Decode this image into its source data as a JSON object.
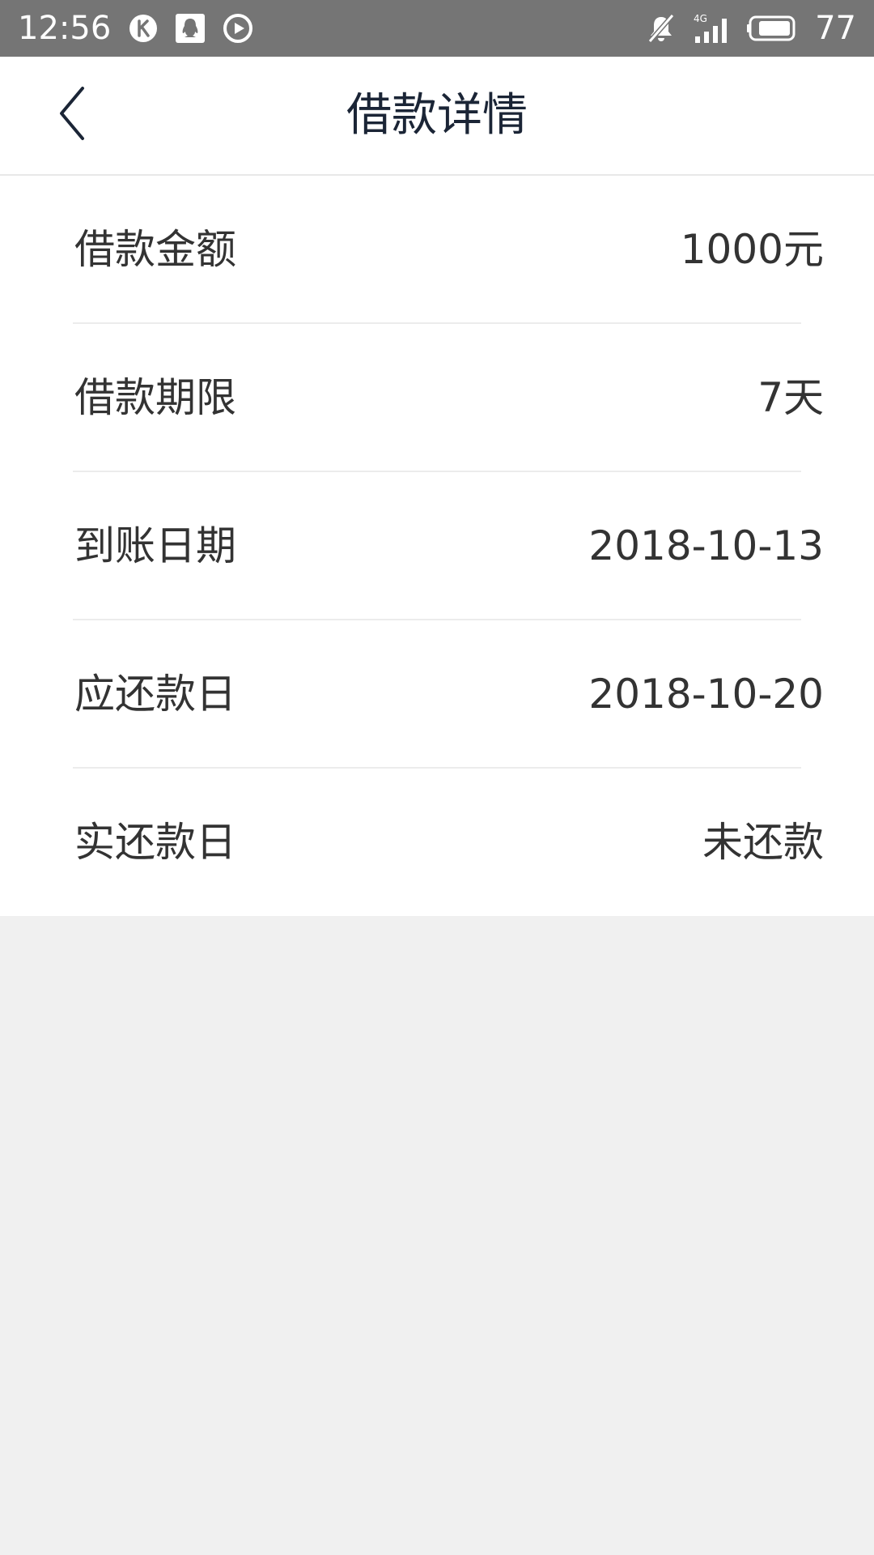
{
  "status_bar": {
    "time": "12:56",
    "icons_left": [
      "k-app-icon",
      "qq-icon",
      "play-icon"
    ],
    "icons_right": [
      "mute-bell-icon",
      "signal-4g-icon",
      "battery-icon"
    ],
    "network_label": "4G",
    "battery_level": "77"
  },
  "header": {
    "title": "借款详情",
    "back_icon": "chevron-left-icon"
  },
  "details": [
    {
      "label": "借款金额",
      "value": "1000元"
    },
    {
      "label": "借款期限",
      "value": "7天"
    },
    {
      "label": "到账日期",
      "value": "2018-10-13"
    },
    {
      "label": "应还款日",
      "value": "2018-10-20"
    },
    {
      "label": "实还款日",
      "value": "未还款"
    }
  ],
  "colors": {
    "status_bar_bg": "#757575",
    "title_text": "#1b2536",
    "body_text": "#333333",
    "divider": "#ececec",
    "page_bg": "#f0f0f0"
  }
}
